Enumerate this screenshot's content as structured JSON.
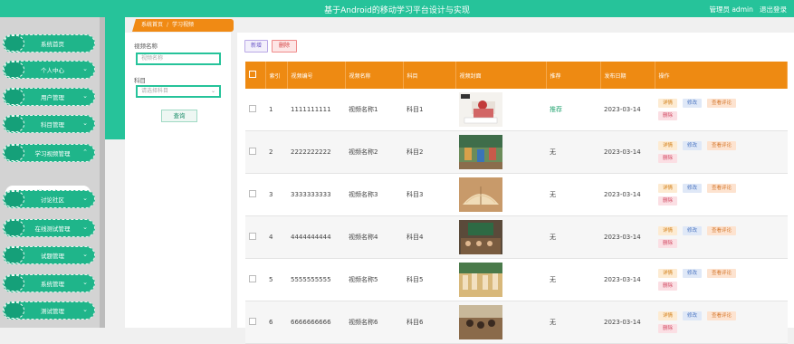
{
  "header": {
    "title": "基于Android的移动学习平台设计与实现",
    "user_text": "管理员 admin",
    "logout": "退出登录"
  },
  "sidebar": {
    "items": [
      {
        "label": "系统首页",
        "has_chevron": false
      },
      {
        "label": "个人中心",
        "has_chevron": true
      },
      {
        "label": "用户管理",
        "has_chevron": true
      },
      {
        "label": "科目管理",
        "has_chevron": true
      },
      {
        "label": "学习视频管理",
        "has_chevron": true
      },
      {
        "label": "讨论社区",
        "has_chevron": true
      },
      {
        "label": "在线测试管理",
        "has_chevron": true
      },
      {
        "label": "试题管理",
        "has_chevron": true
      },
      {
        "label": "系统管理",
        "has_chevron": true
      },
      {
        "label": "测试管理",
        "has_chevron": true
      }
    ],
    "active_sub": "学习视频"
  },
  "breadcrumb": {
    "home": "系统首页",
    "separator": "/",
    "current": "学习视频"
  },
  "filter": {
    "name_label": "视频名称",
    "name_placeholder": "视频名称",
    "subject_label": "科目",
    "subject_placeholder": "请选择科目",
    "query_button": "查询"
  },
  "toolbar": {
    "add": "新增",
    "delete": "删除"
  },
  "table": {
    "columns": [
      "索引",
      "视频编号",
      "视频名称",
      "科目",
      "视频封面",
      "推荐",
      "发布日期",
      "操作"
    ],
    "rows": [
      {
        "index": "1",
        "code": "1111111111",
        "name": "视频名称1",
        "subject": "科目1",
        "recommend": "推荐",
        "date": "2023-03-14"
      },
      {
        "index": "2",
        "code": "2222222222",
        "name": "视频名称2",
        "subject": "科目2",
        "recommend": "无",
        "date": "2023-03-14"
      },
      {
        "index": "3",
        "code": "3333333333",
        "name": "视频名称3",
        "subject": "科目3",
        "recommend": "无",
        "date": "2023-03-14"
      },
      {
        "index": "4",
        "code": "4444444444",
        "name": "视频名称4",
        "subject": "科目4",
        "recommend": "无",
        "date": "2023-03-14"
      },
      {
        "index": "5",
        "code": "5555555555",
        "name": "视频名称5",
        "subject": "科目5",
        "recommend": "无",
        "date": "2023-03-14"
      },
      {
        "index": "6",
        "code": "6666666666",
        "name": "视频名称6",
        "subject": "科目6",
        "recommend": "无",
        "date": "2023-03-14"
      }
    ],
    "actions": {
      "detail": "详情",
      "edit": "修改",
      "review": "查看评论",
      "delete": "删除"
    }
  },
  "colors": {
    "accent": "#26c39a",
    "header_orange": "#ee8a12"
  }
}
